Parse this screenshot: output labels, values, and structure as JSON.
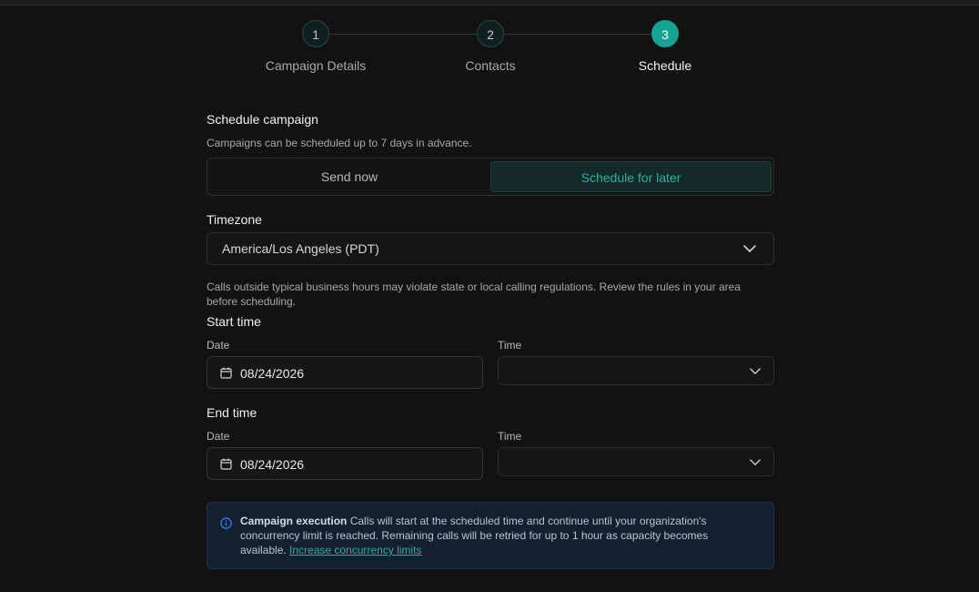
{
  "stepper": {
    "steps": [
      {
        "number": "1",
        "label": "Campaign Details"
      },
      {
        "number": "2",
        "label": "Contacts"
      },
      {
        "number": "3",
        "label": "Schedule"
      }
    ]
  },
  "schedule": {
    "title": "Schedule campaign",
    "subtitle": "Campaigns can be scheduled up to 7 days in advance.",
    "options": {
      "send_now": "Send now",
      "schedule_later": "Schedule for later"
    },
    "selected_option": "Schedule for later"
  },
  "timezone": {
    "label": "Timezone",
    "value": "America/Los Angeles (PDT)",
    "warning": "Calls outside typical business hours may violate state or local calling regulations. Review the rules in your area before scheduling."
  },
  "start": {
    "title": "Start time",
    "date_label": "Date",
    "date_value": "08/24/2026",
    "time_label": "Time",
    "time_value": ""
  },
  "end": {
    "title": "End time",
    "date_label": "Date",
    "date_value": "08/24/2026",
    "time_label": "Time",
    "time_value": ""
  },
  "callout": {
    "title": "Campaign execution",
    "body": " Calls will start at the scheduled time and continue until your organization's concurrency limit is reached. Remaining calls will be retried for up to 1 hour as capacity becomes available. ",
    "link": "Increase concurrency limits"
  },
  "colors": {
    "accent": "#15a394",
    "background": "#121212",
    "info": "#3b82f6"
  }
}
